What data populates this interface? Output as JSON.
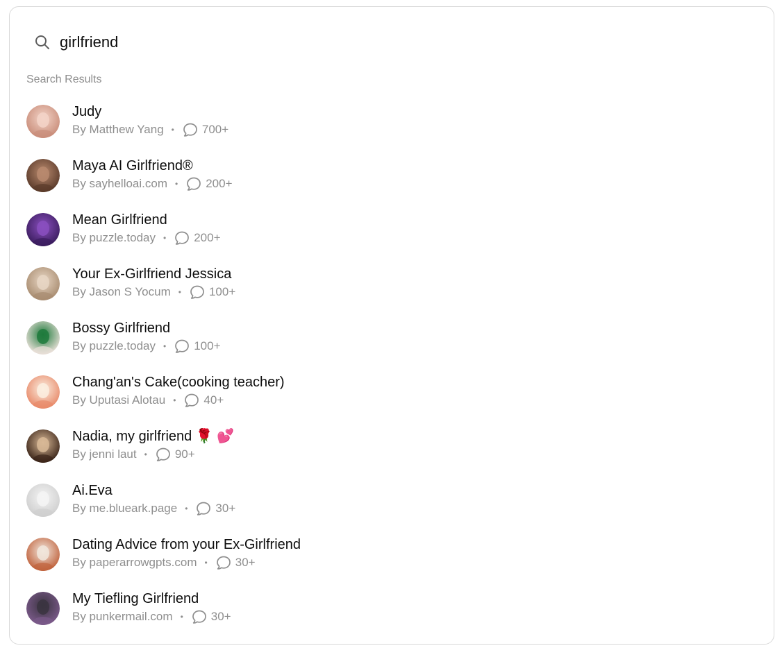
{
  "search": {
    "query": "girlfriend",
    "icon": "search-icon"
  },
  "section_label": "Search Results",
  "results": [
    {
      "name": "Judy",
      "author": "By Matthew Yang",
      "chats": "700+",
      "avatar_colors": [
        "#f3d4c8",
        "#c98d7a"
      ]
    },
    {
      "name": "Maya AI Girlfriend®",
      "author": "By sayhelloai.com",
      "chats": "200+",
      "avatar_colors": [
        "#b98a6e",
        "#5a3a2a"
      ]
    },
    {
      "name": "Mean Girlfriend",
      "author": "By puzzle.today",
      "chats": "200+",
      "avatar_colors": [
        "#8a4fbf",
        "#3b1d5e"
      ]
    },
    {
      "name": "Your Ex-Girlfriend Jessica",
      "author": "By Jason S Yocum",
      "chats": "100+",
      "avatar_colors": [
        "#e8d6c4",
        "#a88c70"
      ]
    },
    {
      "name": "Bossy Girlfriend",
      "author": "By puzzle.today",
      "chats": "100+",
      "avatar_colors": [
        "#1e7a3c",
        "#e9e0d8"
      ]
    },
    {
      "name": "Chang'an's Cake(cooking teacher)",
      "author": "By Uputasi Alotau",
      "chats": "40+",
      "avatar_colors": [
        "#fbeee0",
        "#e88a6a"
      ]
    },
    {
      "name": "Nadia, my girlfriend 🌹 💕",
      "author": "By jenni laut",
      "chats": "90+",
      "avatar_colors": [
        "#d8b896",
        "#3a2418"
      ]
    },
    {
      "name": "Ai.Eva",
      "author": "By me.blueark.page",
      "chats": "30+",
      "avatar_colors": [
        "#f4f4f4",
        "#cfcfcf"
      ]
    },
    {
      "name": "Dating Advice from your Ex-Girlfriend",
      "author": "By paperarrowgpts.com",
      "chats": "30+",
      "avatar_colors": [
        "#f1e6dc",
        "#c0623c"
      ]
    },
    {
      "name": "My Tiefling Girlfriend",
      "author": "By punkermail.com",
      "chats": "30+",
      "avatar_colors": [
        "#3a3440",
        "#7b5a8a"
      ]
    }
  ],
  "colors": {
    "muted": "#8e8e8e",
    "text": "#0d0d0d",
    "border": "#d9d9d9"
  },
  "icons": {
    "chat": "chat-bubble-icon"
  }
}
